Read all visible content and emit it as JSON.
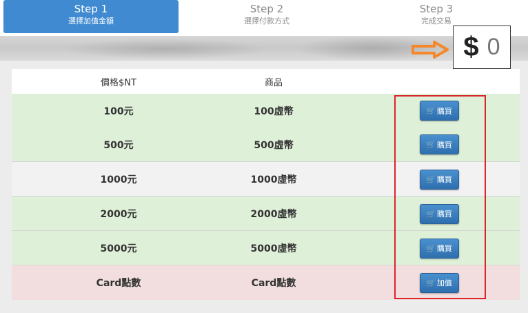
{
  "steps": [
    {
      "title": "Step 1",
      "subtitle": "選擇加值金額"
    },
    {
      "title": "Step 2",
      "subtitle": "選擇付款方式"
    },
    {
      "title": "Step 3",
      "subtitle": "完成交易"
    }
  ],
  "balance": {
    "symbol": "$",
    "amount": "0"
  },
  "table": {
    "headers": [
      "價格$NT",
      "商品"
    ],
    "rows": [
      {
        "price": "100元",
        "product": "100虛幣",
        "button": "購買"
      },
      {
        "price": "500元",
        "product": "500虛幣",
        "button": "購買"
      },
      {
        "price": "1000元",
        "product": "1000虛幣",
        "button": "購買"
      },
      {
        "price": "2000元",
        "product": "2000虛幣",
        "button": "購買"
      },
      {
        "price": "5000元",
        "product": "5000虛幣",
        "button": "購買"
      },
      {
        "price": "Card點數",
        "product": "Card點數",
        "button": "加值"
      }
    ]
  },
  "icons": {
    "cart": "shopping-cart-icon",
    "arrow": "arrow-right-icon"
  },
  "colors": {
    "active_step": "#3f8ad0",
    "button": "#2e6fae",
    "highlight": "#d9262b",
    "arrow": "#f5882a"
  }
}
